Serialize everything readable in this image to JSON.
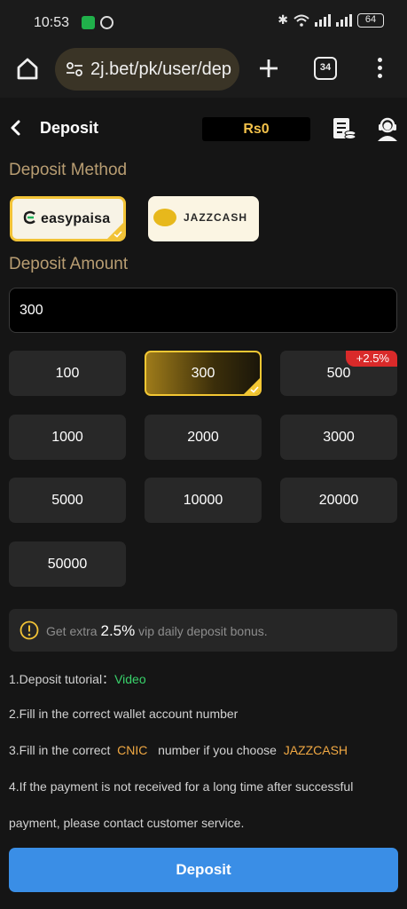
{
  "status_bar": {
    "time": "10:53",
    "battery": "64"
  },
  "browser": {
    "url": "2j.bet/pk/user/dep",
    "tab_count": "34"
  },
  "header": {
    "title": "Deposit",
    "balance": "Rs0"
  },
  "deposit_method": {
    "label": "Deposit Method",
    "methods": [
      {
        "name": "easypaisa",
        "selected": true
      },
      {
        "name": "JAZZCASH",
        "badge_text": "JazzCash",
        "selected": false
      }
    ]
  },
  "deposit_amount": {
    "label": "Deposit Amount",
    "input_value": "300",
    "options": [
      {
        "value": "100"
      },
      {
        "value": "300",
        "selected": true
      },
      {
        "value": "500",
        "badge": "+2.5%"
      },
      {
        "value": "1000"
      },
      {
        "value": "2000"
      },
      {
        "value": "3000"
      },
      {
        "value": "5000"
      },
      {
        "value": "10000"
      },
      {
        "value": "20000"
      },
      {
        "value": "50000"
      }
    ]
  },
  "bonus_info": {
    "prefix": "Get extra",
    "percent": "2.5%",
    "suffix": "vip daily deposit bonus."
  },
  "notes": {
    "tutorial_prefix": "1.Deposit tutorial：",
    "tutorial_link": "Video",
    "line2": "2.Fill in the correct wallet account number",
    "line3_prefix": "3.Fill in the correct",
    "line3_cnic": "CNIC",
    "line3_middle": "number if you choose",
    "line3_jazz": "JAZZCASH",
    "line4": "4.If the payment is not received for a long time after successful",
    "line5": "payment, please contact customer service."
  },
  "deposit_button": "Deposit",
  "colors": {
    "accent_gold": "#f3c733",
    "primary_blue": "#3a8ee6",
    "badge_red": "#d92a2a",
    "link_green": "#39d26b"
  }
}
